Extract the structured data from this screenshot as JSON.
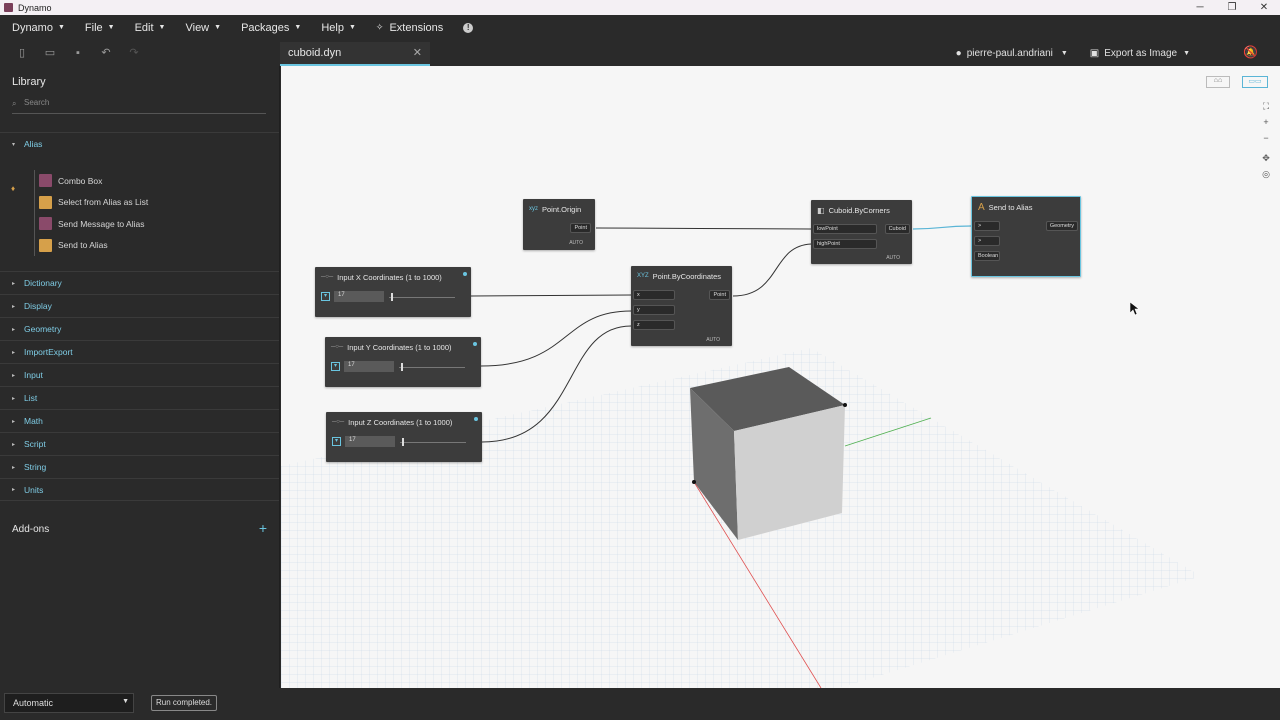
{
  "window": {
    "title": "Dynamo"
  },
  "menu": {
    "items": [
      {
        "label": "Dynamo"
      },
      {
        "label": "File"
      },
      {
        "label": "Edit"
      },
      {
        "label": "View"
      },
      {
        "label": "Packages"
      },
      {
        "label": "Help"
      },
      {
        "label": "Extensions"
      }
    ]
  },
  "tab": {
    "name": "cuboid.dyn"
  },
  "user": {
    "name": "pierre-paul.andriani",
    "export_label": "Export as Image"
  },
  "library": {
    "title": "Library",
    "search_placeholder": "Search",
    "alias": {
      "label": "Alias",
      "items": [
        "Combo Box",
        "Select from Alias as List",
        "Send Message to Alias",
        "Send to Alias"
      ]
    },
    "categories": [
      "Dictionary",
      "Display",
      "Geometry",
      "ImportExport",
      "Input",
      "List",
      "Math",
      "Script",
      "String",
      "Units"
    ],
    "addons_label": "Add-ons"
  },
  "nodes": {
    "point_origin": {
      "title": "Point.Origin",
      "out": "Point",
      "auto": "AUTO"
    },
    "point_bycoords": {
      "title": "Point.ByCoordinates",
      "in": [
        "x",
        "y",
        "z"
      ],
      "out": "Point",
      "auto": "AUTO"
    },
    "cuboid": {
      "title": "Cuboid.ByCorners",
      "in": [
        "lowPoint",
        "highPoint"
      ],
      "out": "Cuboid",
      "auto": "AUTO"
    },
    "send_alias": {
      "title": "Send to Alias",
      "in": [
        "Boolean"
      ],
      "out": "Geometry"
    },
    "input_x": {
      "title": "Input X Coordinates (1 to 1000)",
      "value": "17"
    },
    "input_y": {
      "title": "Input Y Coordinates (1 to 1000)",
      "value": "17"
    },
    "input_z": {
      "title": "Input Z Coordinates (1 to 1000)",
      "value": "17"
    }
  },
  "status": {
    "run_mode": "Automatic",
    "run_status": "Run completed."
  },
  "colors": {
    "accent": "#6ac5e0",
    "node_bg": "#3c3c3c",
    "canvas_bg": "#f6f6f6"
  }
}
